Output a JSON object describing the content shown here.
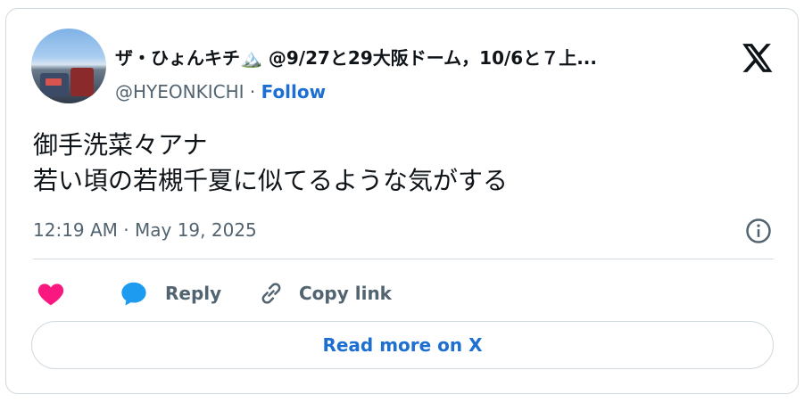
{
  "header": {
    "display_name": "ザ・ひょんキチ🏔️ @9/27と29大阪ドーム，10/6と７上...",
    "handle": "@HYEONKICHI",
    "separator": "·",
    "follow_label": "Follow"
  },
  "tweet": {
    "text": "御手洗菜々アナ\n若い頃の若槻千夏に似てるような気がする",
    "timestamp": "12:19 AM · May 19, 2025"
  },
  "actions": {
    "reply_label": "Reply",
    "copy_link_label": "Copy link"
  },
  "footer": {
    "read_more_label": "Read more on X"
  },
  "colors": {
    "accent": "#1d6fd1",
    "heart": "#f91880",
    "reply_bubble": "#1d9bf0",
    "muted": "#536471",
    "border": "#cfd9de"
  },
  "icons": [
    "x-logo-icon",
    "info-icon",
    "heart-icon",
    "reply-bubble-icon",
    "link-icon"
  ]
}
